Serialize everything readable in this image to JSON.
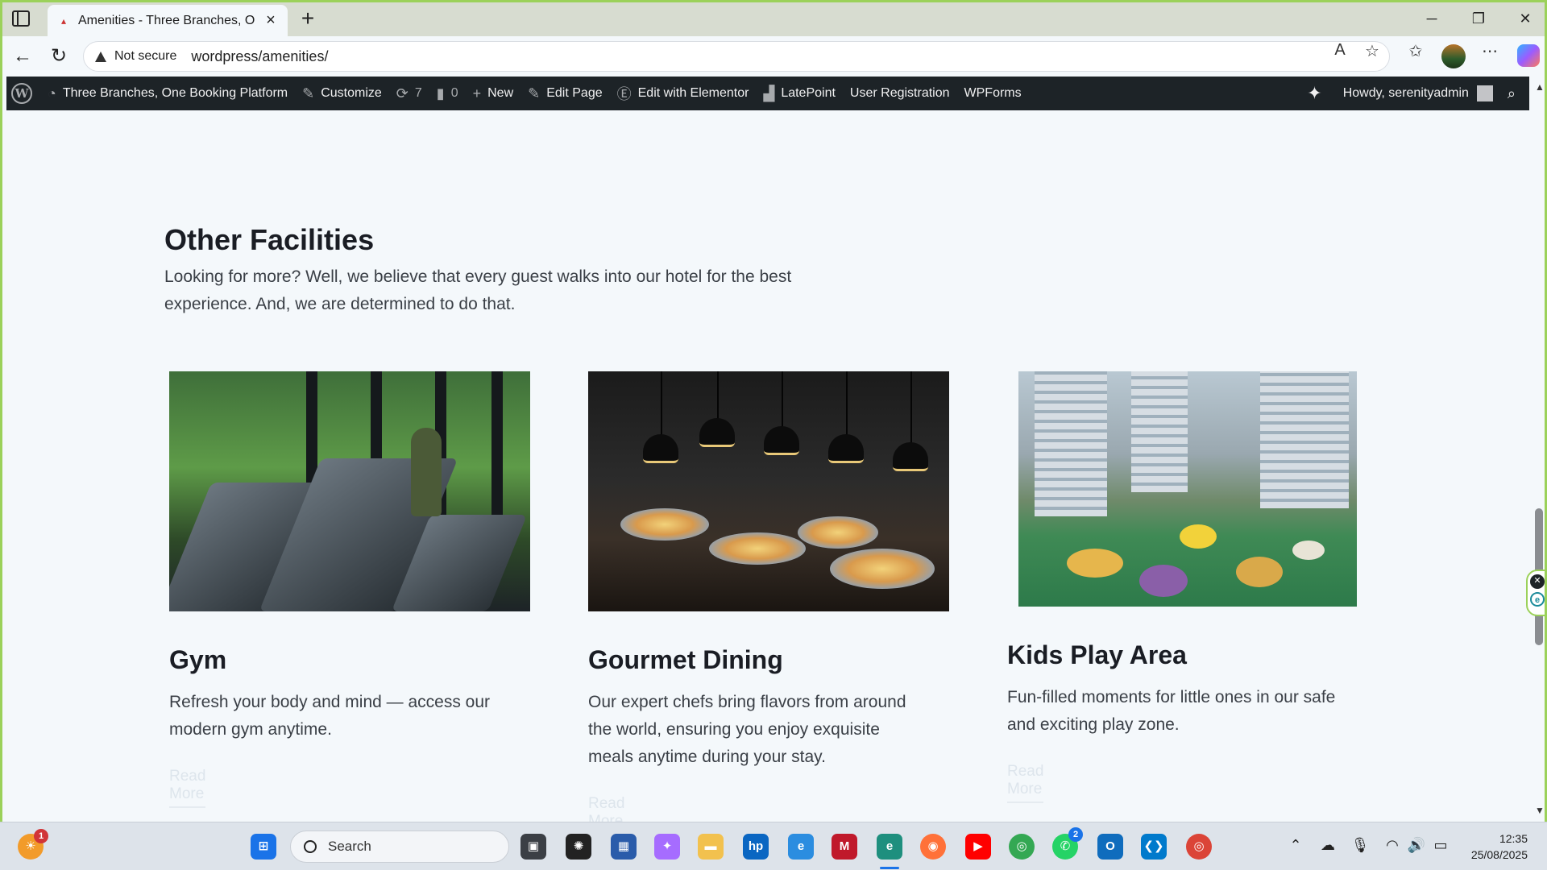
{
  "browser": {
    "tab_title": "Amenities - Three Branches, One Booking Platform",
    "tab_close_icon": "×",
    "new_tab_icon": "+",
    "not_secure": "Not secure",
    "url": "wordpress/amenities/"
  },
  "adminbar": {
    "site_name": "Three Branches, One Booking Platform",
    "customize": "Customize",
    "updates_count": "7",
    "comments_count": "0",
    "new": "New",
    "edit_page": "Edit Page",
    "edit_elementor": "Edit with Elementor",
    "latepoint": "LatePoint",
    "user_registration": "User Registration",
    "wpforms": "WPForms",
    "howdy": "Howdy, serenityadmin"
  },
  "section": {
    "title": "Other Facilities",
    "description": "Looking for more? Well, we believe that every guest walks into our hotel for the best experience. And, we are determined to do that."
  },
  "cards": [
    {
      "title": "Gym",
      "text": "Refresh your body and mind — access our modern gym anytime.",
      "link": "Read More"
    },
    {
      "title": "Gourmet Dining",
      "text": "Our expert chefs bring flavors from around the world, ensuring you enjoy exquisite meals anytime during your stay.",
      "link": "Read More"
    },
    {
      "title": "Kids Play Area",
      "text": "Fun-filled moments for little ones in our safe and exciting play zone.",
      "link": "Read More"
    }
  ],
  "taskbar": {
    "search_label": "Search",
    "time": "12:35",
    "date": "25/08/2025",
    "weather_badge": "1",
    "whatsapp_badge": "2"
  },
  "colors": {
    "window_border": "#9bd15a",
    "adminbar_bg": "#1d2327",
    "page_bg": "#f4f8fb",
    "heading": "#1a1d24"
  }
}
